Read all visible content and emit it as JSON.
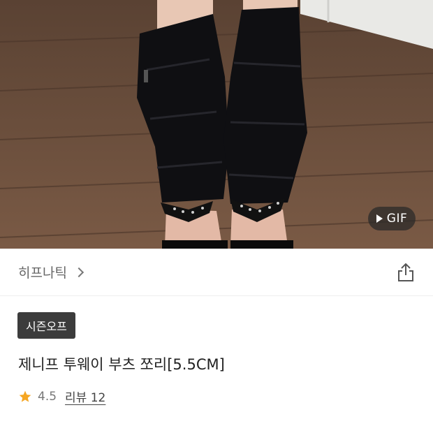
{
  "hero": {
    "media_type_label": "GIF"
  },
  "brand": {
    "name": "히프나틱"
  },
  "product": {
    "tag": "시즌오프",
    "title": "제니프 투웨이 부츠 쪼리[5.5CM]",
    "rating": "4.5",
    "review_label": "리뷰 12"
  },
  "colors": {
    "star": "#f5a623",
    "tag_bg": "#3c3c3c"
  }
}
